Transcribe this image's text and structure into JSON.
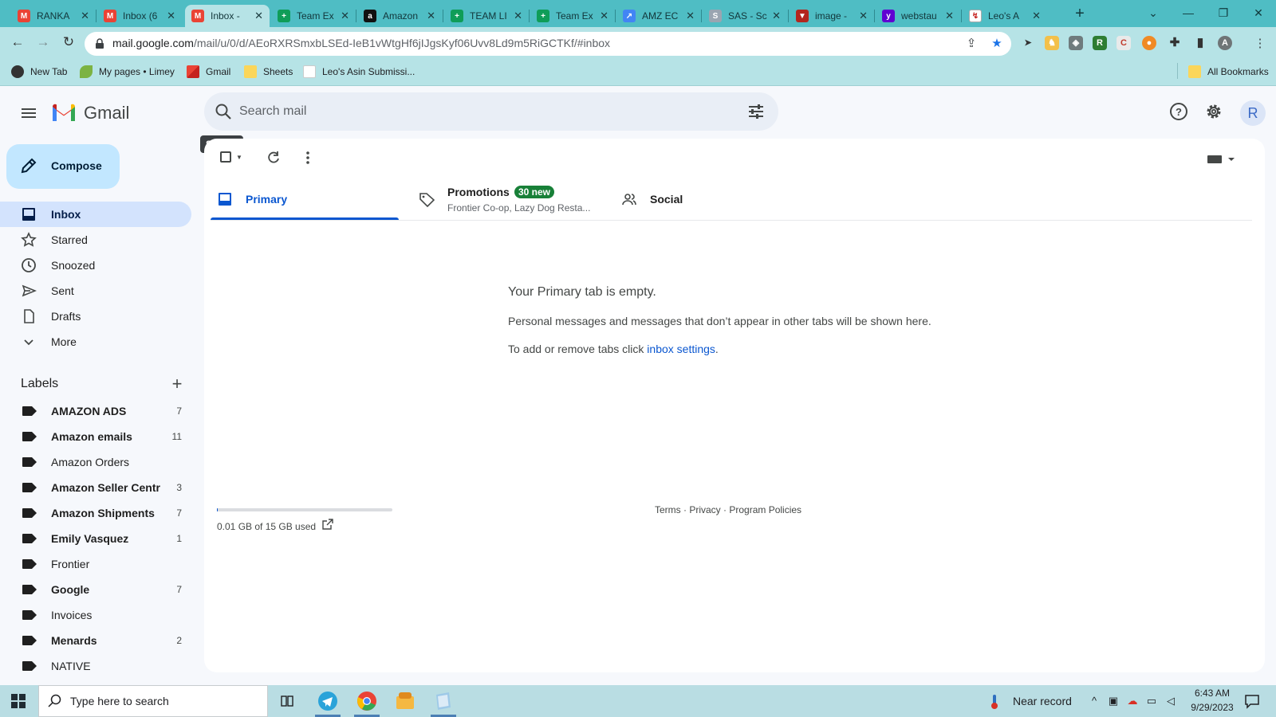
{
  "browser": {
    "tabs": [
      {
        "label": "RANKA",
        "favicon": "gmail-icon",
        "active": false
      },
      {
        "label": "Inbox (6",
        "favicon": "gmail-icon",
        "active": false
      },
      {
        "label": "Inbox -",
        "favicon": "gmail-icon",
        "active": true
      },
      {
        "label": "Team Ex",
        "favicon": "sheets-icon",
        "active": false
      },
      {
        "label": "Amazon",
        "favicon": "amazon-icon",
        "active": false
      },
      {
        "label": "TEAM LI",
        "favicon": "sheets-icon",
        "active": false
      },
      {
        "label": "Team Ex",
        "favicon": "sheets-icon",
        "active": false
      },
      {
        "label": "AMZ EC",
        "favicon": "chart-icon",
        "active": false
      },
      {
        "label": "SAS - Sc",
        "favicon": "sas-icon",
        "active": false
      },
      {
        "label": "image -",
        "favicon": "image-icon",
        "active": false
      },
      {
        "label": "webstau",
        "favicon": "yahoo-icon",
        "active": false
      },
      {
        "label": "Leo's A",
        "favicon": "leo-icon",
        "active": false
      }
    ],
    "url_host": "mail.google.com",
    "url_path": "/mail/u/0/d/AEoRXRSmxbLSEd-IeB1vWtgHf6jIJgsKyf06Uvv8Ld9m5RiGCTKf/#inbox",
    "bookmarks": [
      {
        "label": "New Tab",
        "icon": "globe-icon"
      },
      {
        "label": "My pages • Limey",
        "icon": "leaf-icon"
      },
      {
        "label": "Gmail",
        "icon": "gmail-icon"
      },
      {
        "label": "Sheets",
        "icon": "folder-icon"
      },
      {
        "label": "Leo's Asin Submissi...",
        "icon": "leo-icon"
      }
    ],
    "all_bookmarks": "All Bookmarks",
    "profile_letter": "A",
    "accent": "#4fbdc4"
  },
  "gmail": {
    "logo_text": "Gmail",
    "search_placeholder": "Search mail",
    "search_tooltip": "Search",
    "avatar_letter": "R",
    "compose_label": "Compose",
    "nav": [
      {
        "label": "Inbox",
        "icon": "inbox-icon",
        "active": true
      },
      {
        "label": "Starred",
        "icon": "star-icon",
        "active": false
      },
      {
        "label": "Snoozed",
        "icon": "clock-icon",
        "active": false
      },
      {
        "label": "Sent",
        "icon": "send-icon",
        "active": false
      },
      {
        "label": "Drafts",
        "icon": "draft-icon",
        "active": false
      },
      {
        "label": "More",
        "icon": "chevron-down-icon",
        "active": false
      }
    ],
    "labels_heading": "Labels",
    "labels": [
      {
        "name": "AMAZON ADS",
        "count": "7",
        "bold": true
      },
      {
        "name": "Amazon emails",
        "count": "11",
        "bold": true
      },
      {
        "name": "Amazon Orders",
        "count": "",
        "bold": false
      },
      {
        "name": "Amazon Seller Centr",
        "count": "3",
        "bold": true
      },
      {
        "name": "Amazon Shipments",
        "count": "7",
        "bold": true
      },
      {
        "name": "Emily Vasquez",
        "count": "1",
        "bold": true
      },
      {
        "name": "Frontier",
        "count": "",
        "bold": false
      },
      {
        "name": "Google",
        "count": "7",
        "bold": true
      },
      {
        "name": "Invoices",
        "count": "",
        "bold": false
      },
      {
        "name": "Menards",
        "count": "2",
        "bold": true
      },
      {
        "name": "NATIVE",
        "count": "",
        "bold": false
      }
    ],
    "tabs": {
      "primary": "Primary",
      "promotions": "Promotions",
      "promotions_badge": "30 new",
      "promotions_snippet": "Frontier Co-op, Lazy Dog Resta...",
      "social": "Social"
    },
    "empty": {
      "title": "Your Primary tab is empty.",
      "body": "Personal messages and messages that don’t appear in other tabs will be shown here.",
      "hint_prefix": "To add or remove tabs click ",
      "hint_link": "inbox settings",
      "hint_suffix": "."
    },
    "storage": {
      "text": "0.01 GB of 15 GB used",
      "fraction": 0.001
    },
    "footer": {
      "terms": "Terms",
      "privacy": "Privacy",
      "policies": "Program Policies",
      "sep": " · "
    },
    "accent": "#0b57d0",
    "badge_color": "#188038"
  },
  "taskbar": {
    "search_placeholder": "Type here to search",
    "weather": "Near record",
    "time": "6:43 AM",
    "date": "9/29/2023"
  }
}
